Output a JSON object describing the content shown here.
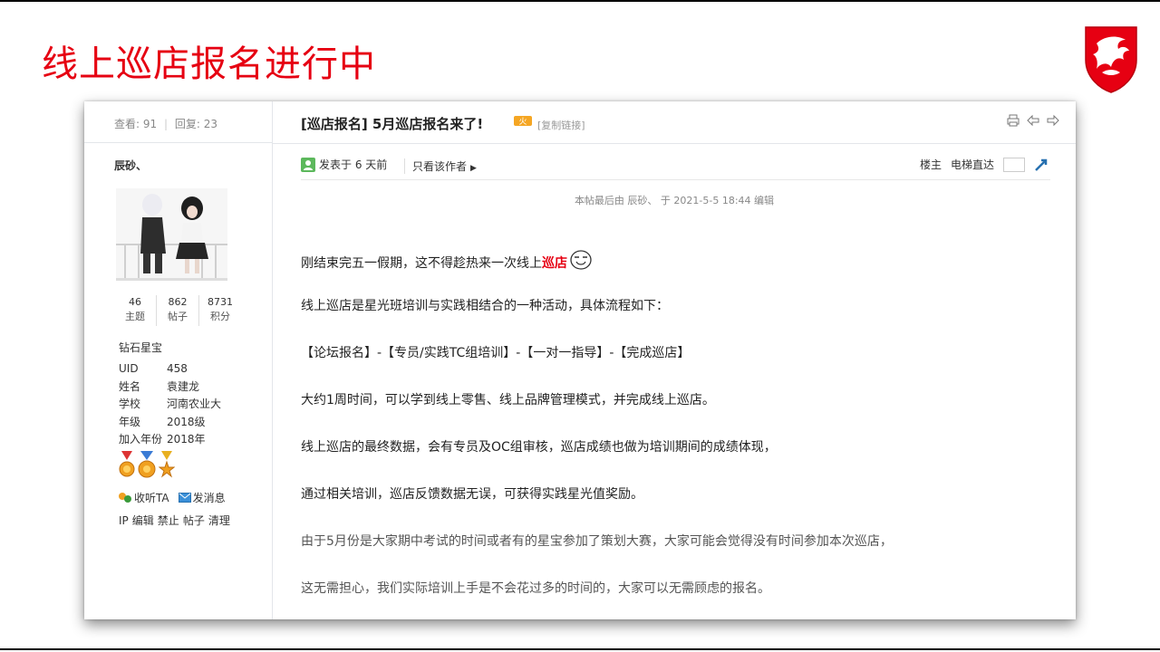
{
  "slide": {
    "title": "线上巡店报名进行中",
    "brand_color": "#e60012"
  },
  "thread": {
    "views_label": "查看:",
    "views": "91",
    "replies_label": "回复:",
    "replies": "23",
    "title": "[巡店报名] 5月巡店报名来了!",
    "copy_link": "[复制链接]"
  },
  "author": {
    "name": "辰砂、",
    "stats": [
      {
        "value": "46",
        "label": "主题"
      },
      {
        "value": "862",
        "label": "帖子"
      },
      {
        "value": "8731",
        "label": "积分"
      }
    ],
    "rank": "钻石星宝",
    "profile": [
      {
        "key": "UID",
        "value": "458"
      },
      {
        "key": "姓名",
        "value": "袁建龙"
      },
      {
        "key": "学校",
        "value": "河南农业大"
      },
      {
        "key": "年级",
        "value": "2018级"
      },
      {
        "key": "加入年份",
        "value": "2018年"
      }
    ],
    "follow": "收听TA",
    "message": "发消息",
    "admin": [
      "IP",
      "编辑",
      "禁止",
      "帖子",
      "清理"
    ]
  },
  "post": {
    "posted": "发表于 6 天前",
    "only_author": "只看该作者",
    "floor": "楼主",
    "jump": "电梯直达",
    "edited": "本帖最后由 辰砂、 于 2021-5-5 18:44 编辑",
    "p1_text": "刚结束完五一假期，这不得趁热来一次线上",
    "p1_highlight": "巡店",
    "paragraphs": [
      "线上巡店是星光班培训与实践相结合的一种活动，具体流程如下：",
      "【论坛报名】-【专员/实践TC组培训】-【一对一指导】-【完成巡店】",
      "大约1周时间，可以学到线上零售、线上品牌管理模式，并完成线上巡店。",
      "线上巡店的最终数据，会有专员及OC组审核，巡店成绩也做为培训期间的成绩体现，",
      "通过相关培训，巡店反馈数据无误，可获得实践星光值奖励。",
      "由于5月份是大家期中考试的时间或者有的星宝参加了策划大赛，大家可能会觉得没有时间参加本次巡店，",
      "这无需担心，我们实际培训上手是不会花过多的时间的，大家可以无需顾虑的报名。"
    ]
  }
}
